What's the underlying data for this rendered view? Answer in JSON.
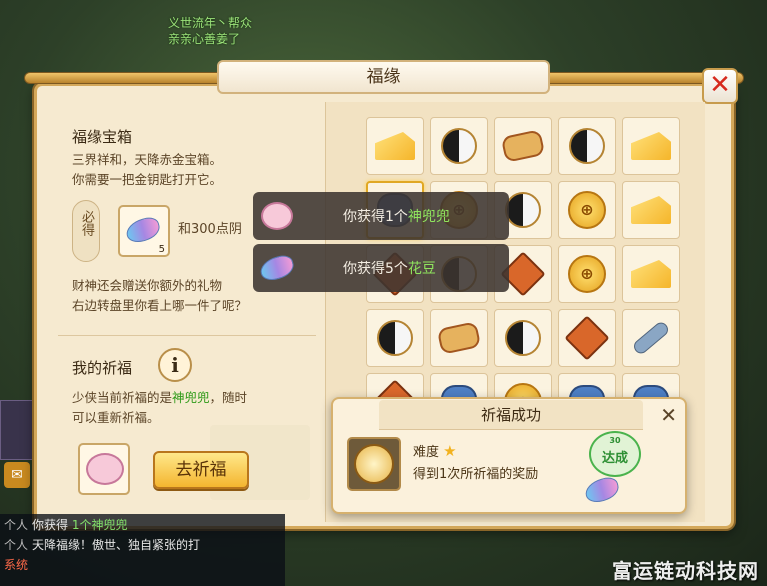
{
  "background": {
    "top_line1": "义世流年丶帮众",
    "top_line2": "亲亲心善姜了"
  },
  "window": {
    "title": "福缘",
    "close_icon": "close-x-icon"
  },
  "treasure": {
    "title": "福缘宝箱",
    "desc_line1": "三界祥和，天降赤金宝箱。",
    "desc_line2": "你需要一把金钥匙打开它。",
    "must_get_label": "必得",
    "reward_text": "和300点阴",
    "extra_line1": "财神还会赠送你额外的礼物",
    "extra_line2": "右边转盘里你看上哪一件了呢？",
    "item_count": "5"
  },
  "blessing": {
    "title": "我的祈福",
    "info_label": "i",
    "line1_prefix": "少侠当前祈福的是",
    "line1_highlight": "神兜兜",
    "line1_suffix": "，随时",
    "line2": "可以重新祈福。",
    "go_button": "去祈福"
  },
  "grid": {
    "rows": [
      [
        "cheese",
        "taiji",
        "scroll",
        "taiji",
        "cheese"
      ],
      [
        "bag",
        "coin",
        "taiji",
        "coin",
        "cheese"
      ],
      [
        "hammer",
        "taiji",
        "hammer",
        "coin",
        "cheese"
      ],
      [
        "taiji",
        "scroll",
        "taiji",
        "hammer",
        "key"
      ],
      [
        "hammer",
        "bag",
        "coin",
        "bag",
        "bag"
      ]
    ],
    "selected_row": 1,
    "selected_col": 0
  },
  "toasts": [
    {
      "prefix": "你获得",
      "count": "1个",
      "item": "神兜兜",
      "icon": "pig-icon"
    },
    {
      "prefix": "你获得",
      "count": "5个",
      "item": "花豆",
      "icon": "bean-icon"
    }
  ],
  "popup": {
    "title": "祈福成功",
    "close_label": "✕",
    "difficulty_label": "难度",
    "reward_line": "得到1次所祈福的奖励",
    "stamp_top": "30",
    "stamp_text": "达成"
  },
  "chat": {
    "line1_tag": "个人",
    "line1_text": "你获得",
    "line1_hl": "1个神兜兜",
    "line2_tag": "个人",
    "line2_text": "天降福缘！傲世、独自紧张的打",
    "line3_tag": "系统"
  },
  "watermark": "富运链动科技网",
  "colors": {
    "panel_bg": "#f6ead0",
    "accent_gold": "#d4a85a",
    "highlight_green": "#2e9a18",
    "close_red": "#d62a1e"
  }
}
